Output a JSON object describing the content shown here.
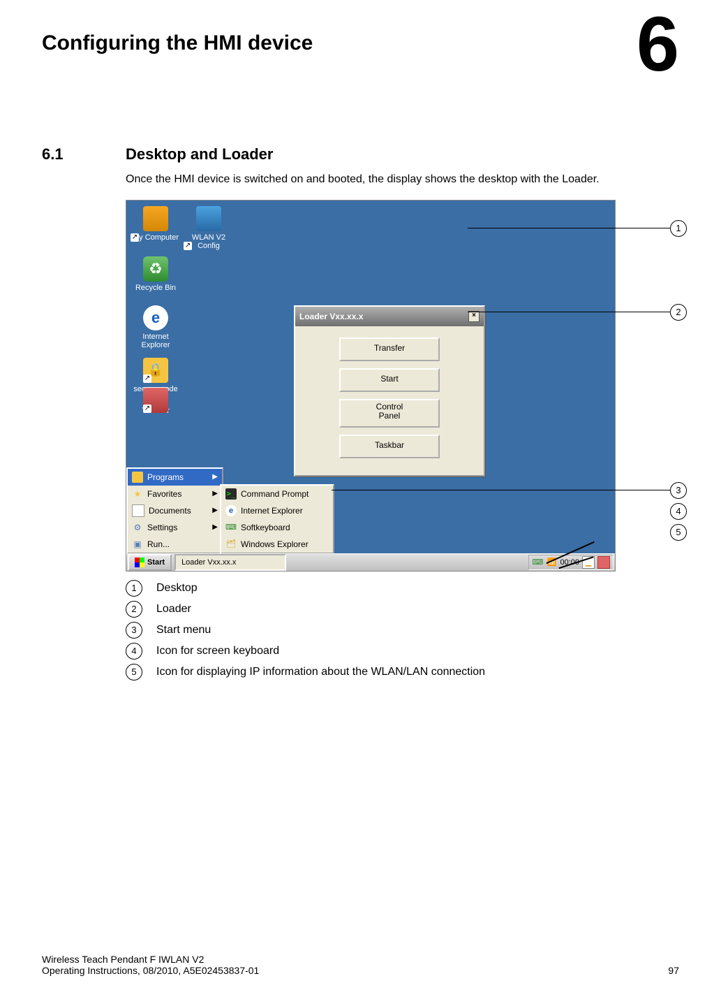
{
  "chapter": {
    "title": "Configuring the HMI device",
    "number": "6"
  },
  "section": {
    "number": "6.1",
    "title": "Desktop and Loader"
  },
  "body": "Once the HMI device is switched on and booted, the display shows the desktop with the Loader.",
  "desktop_icons": {
    "my_computer": "My Computer",
    "wlan_config": "WLAN V2 Config",
    "recycle_bin": "Recycle Bin",
    "internet_explorer": "Internet Explorer",
    "secure_mode": "secure mode",
    "taskbar": "TaskBar"
  },
  "loader": {
    "title": "Loader Vxx.xx.x",
    "buttons": {
      "transfer": "Transfer",
      "start": "Start",
      "control_panel_l1": "Control",
      "control_panel_l2": "Panel",
      "taskbar": "Taskbar"
    }
  },
  "start_menu": {
    "programs": "Programs",
    "favorites": "Favorites",
    "documents": "Documents",
    "settings": "Settings",
    "run": "Run...",
    "submenu": {
      "command_prompt": "Command Prompt",
      "internet_explorer": "Internet Explorer",
      "softkeyboard": "Softkeyboard",
      "windows_explorer": "Windows Explorer"
    }
  },
  "taskbar": {
    "start": "Start",
    "loader_task": "Loader Vxx.xx.x",
    "time": "00:00"
  },
  "callouts": {
    "c1": "1",
    "c2": "2",
    "c3": "3",
    "c4": "4",
    "c5": "5"
  },
  "legend": {
    "l1": "Desktop",
    "l2": "Loader",
    "l3": "Start menu",
    "l4": "Icon for screen keyboard",
    "l5": "Icon for displaying IP information about the WLAN/LAN connection"
  },
  "footer": {
    "line1": "Wireless Teach Pendant F IWLAN V2",
    "line2": "Operating Instructions, 08/2010, A5E02453837-01",
    "page": "97"
  }
}
